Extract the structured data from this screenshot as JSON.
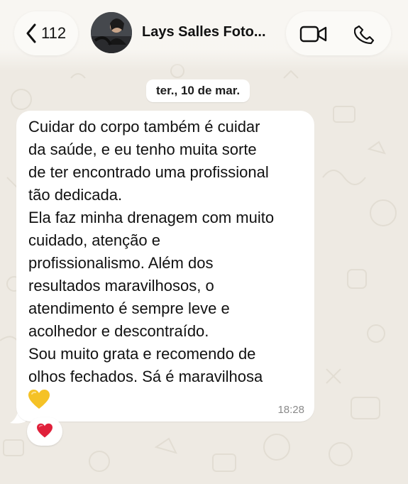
{
  "header": {
    "back_count": "112",
    "contact_name": "Lays Salles Foto..."
  },
  "date_chip": "ter., 10 de mar.",
  "message": {
    "lines": [
      "Cuidar do corpo também é cuidar",
      "da saúde, e eu tenho muita sorte",
      "de ter encontrado uma profissional",
      "tão dedicada.",
      "Ela faz minha drenagem com muito",
      "cuidado, atenção e",
      "profissionalismo. Além dos",
      "resultados maravilhosos, o",
      "atendimento é sempre leve e",
      "acolhedor e descontraído.",
      "Sou muito grata e recomendo de",
      "olhos fechados. Sá é maravilhosa"
    ],
    "emoji": "yellow-heart",
    "time": "18:28"
  },
  "reaction": {
    "emoji": "red-heart"
  },
  "colors": {
    "wallpaper": "#eeeae3",
    "bubble": "#ffffff",
    "heart_red": "#e0203a",
    "heart_yellow": "#f5c226"
  }
}
